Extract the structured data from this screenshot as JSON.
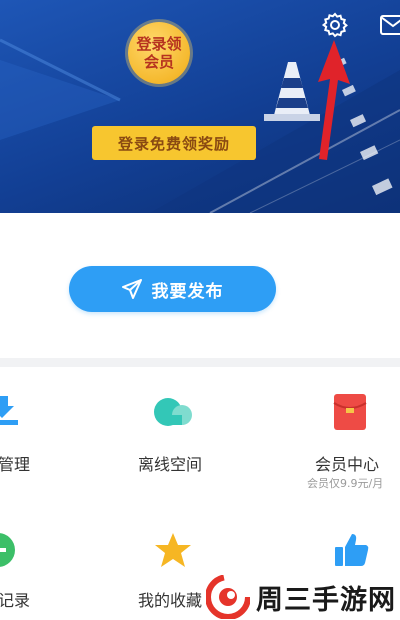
{
  "header": {
    "member_badge_line1": "登录领",
    "member_badge_line2": "会员",
    "login_reward_label": "登录免费领奖励",
    "settings_icon": "gear-icon",
    "message_icon": "mail-icon"
  },
  "publish": {
    "label": "我要发布",
    "icon": "paper-plane-icon"
  },
  "grid": {
    "items": [
      {
        "label": "管理",
        "icon": "download-icon",
        "color": "#2e9ef5"
      },
      {
        "label": "离线空间",
        "icon": "cloud-icon",
        "color": "#33c7b7"
      },
      {
        "label": "会员中心",
        "sublabel": "会员仅9.9元/月",
        "icon": "red-envelope-icon",
        "color": "#ee4b45"
      },
      {
        "label": "记录",
        "icon": "record-icon",
        "color": "#3cbf68"
      },
      {
        "label": "我的收藏",
        "icon": "star-icon",
        "color": "#f6b623"
      },
      {
        "label": "",
        "icon": "thumbs-up-icon",
        "color": "#2e9ef5"
      }
    ]
  },
  "watermark": {
    "text": "周三手游网",
    "logo_color": "#e5342a"
  }
}
